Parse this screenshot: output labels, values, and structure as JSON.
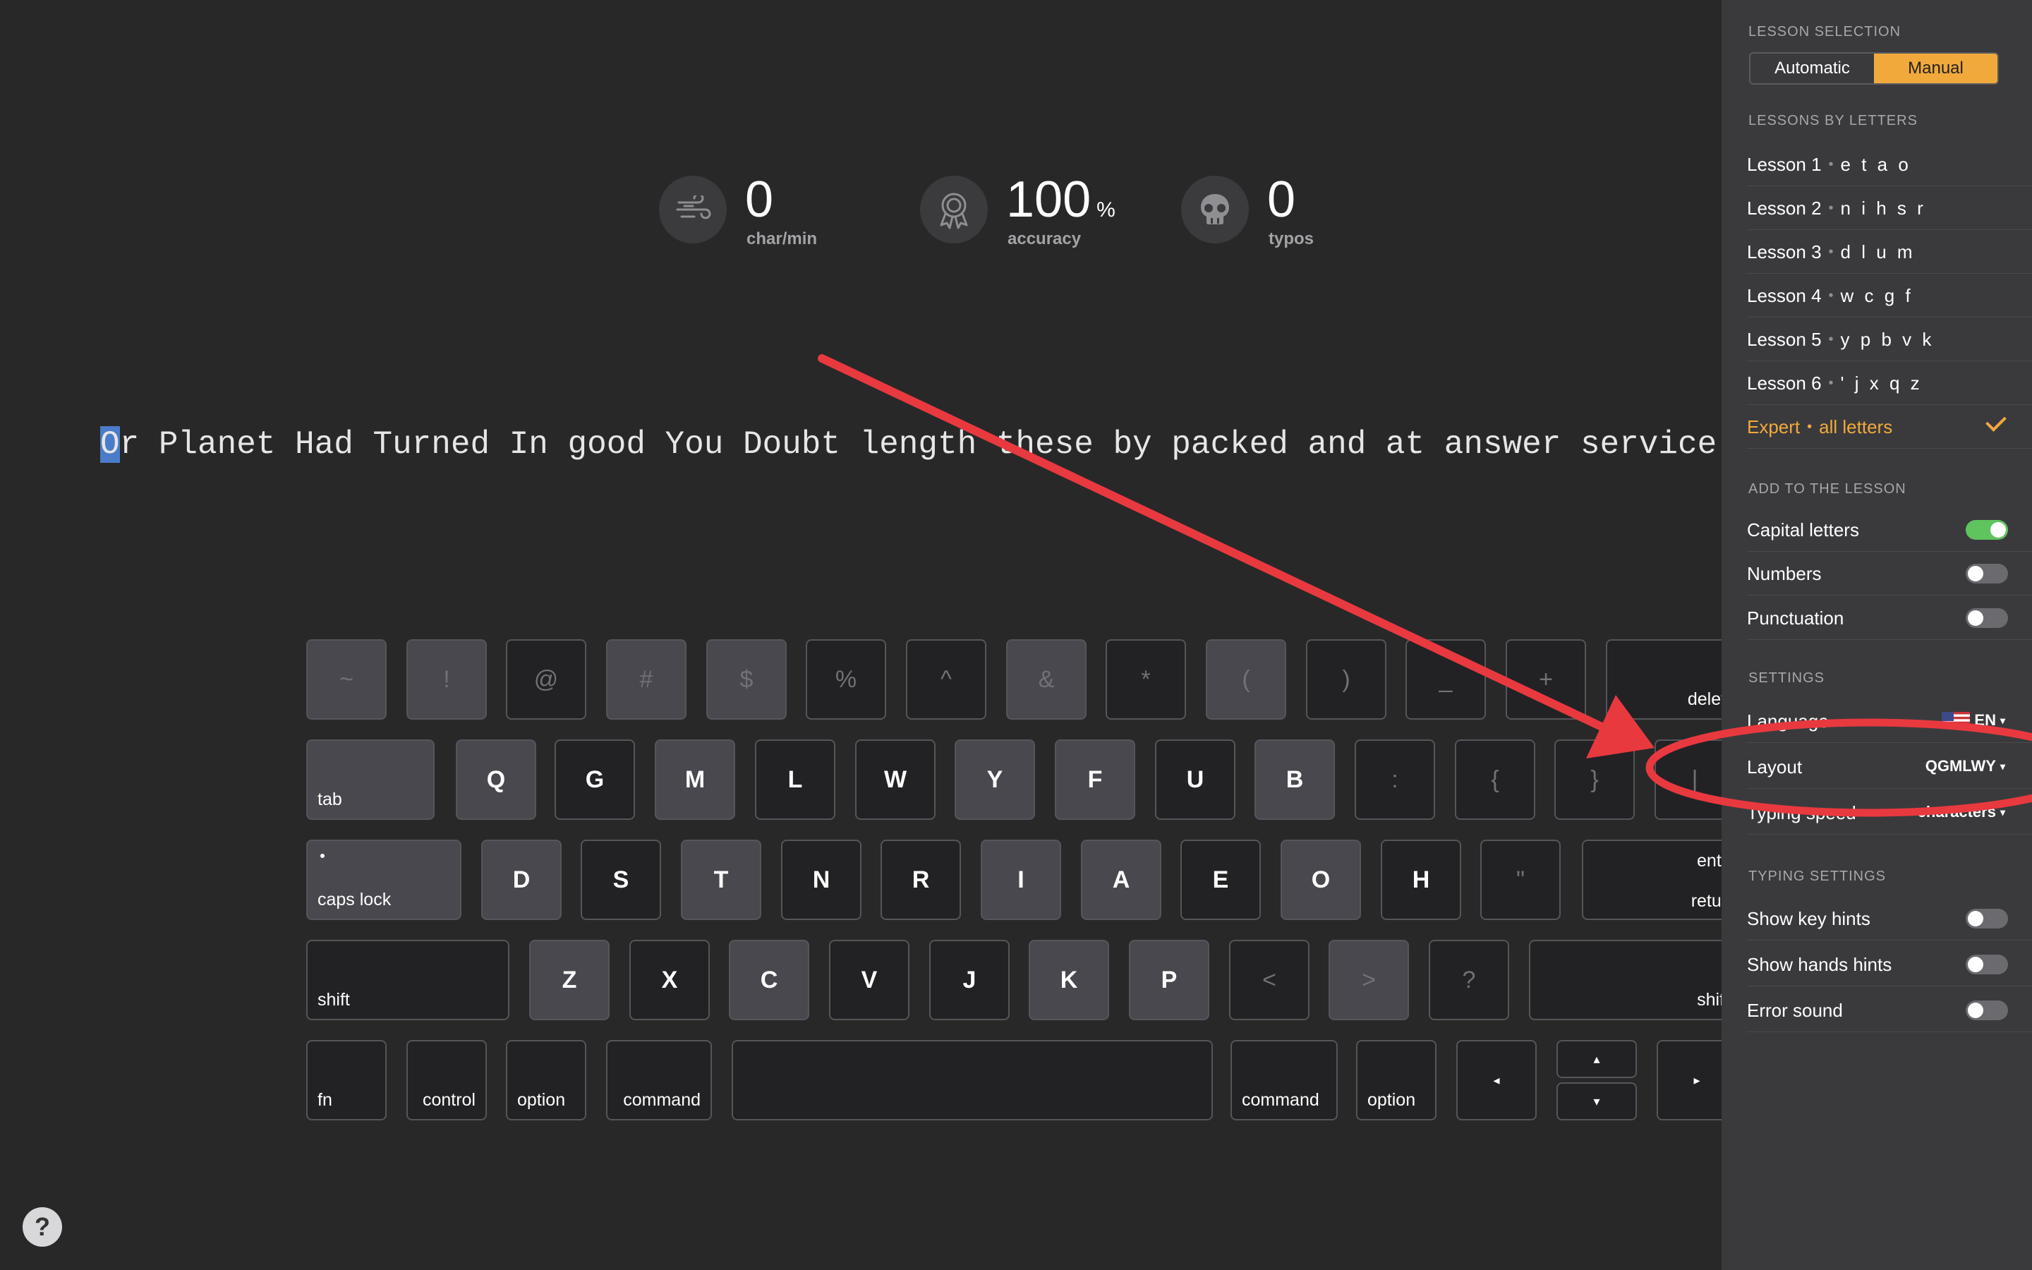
{
  "stats": [
    {
      "value": "0",
      "unit": "",
      "label": "char/min",
      "icon": "wind-icon"
    },
    {
      "value": "100",
      "unit": "%",
      "label": "accuracy",
      "icon": "award-icon"
    },
    {
      "value": "0",
      "unit": "",
      "label": "typos",
      "icon": "skull-icon"
    }
  ],
  "lesson_text": {
    "cursor_char": "O",
    "rest": "r Planet Had Turned In good You Doubt length these by packed and at answer service the m"
  },
  "keyboard": {
    "row1": [
      "~",
      "!",
      "@",
      "#",
      "$",
      "%",
      "^",
      "&",
      "*",
      "(",
      ")",
      "_",
      "+",
      "delete"
    ],
    "row2": [
      "tab",
      "Q",
      "G",
      "M",
      "L",
      "W",
      "Y",
      "F",
      "U",
      "B",
      ":",
      "{",
      "}",
      "|"
    ],
    "row3": [
      "caps lock",
      "D",
      "S",
      "T",
      "N",
      "R",
      "I",
      "A",
      "E",
      "O",
      "H",
      "\"",
      "enter",
      "return"
    ],
    "row4": [
      "shift",
      "Z",
      "X",
      "C",
      "V",
      "J",
      "K",
      "P",
      "<",
      ">",
      "?",
      "shift"
    ],
    "row5": [
      "fn",
      "control",
      "option",
      "command",
      "",
      "command",
      "option",
      "◂",
      "▴",
      "▾",
      "▸"
    ]
  },
  "help_label": "?",
  "sidebar": {
    "lesson_selection_title": "LESSON SELECTION",
    "mode_automatic": "Automatic",
    "mode_manual": "Manual",
    "lessons_title": "LESSONS BY LETTERS",
    "lessons": [
      {
        "name": "Lesson 1",
        "sep": "•",
        "letters": "e t a o"
      },
      {
        "name": "Lesson 2",
        "sep": "•",
        "letters": "n i h s r"
      },
      {
        "name": "Lesson 3",
        "sep": "•",
        "letters": "d l u m"
      },
      {
        "name": "Lesson 4",
        "sep": "•",
        "letters": "w c g f"
      },
      {
        "name": "Lesson 5",
        "sep": "•",
        "letters": "y p b v k"
      },
      {
        "name": "Lesson 6",
        "sep": "•",
        "letters": "' j x q z"
      },
      {
        "name": "Expert",
        "sep": "•",
        "letters": "all letters"
      }
    ],
    "add_title": "ADD TO THE LESSON",
    "add_options": [
      {
        "label": "Capital letters",
        "on": true
      },
      {
        "label": "Numbers",
        "on": false
      },
      {
        "label": "Punctuation",
        "on": false
      }
    ],
    "settings_title": "SETTINGS",
    "language_label": "Language",
    "language_value": "EN",
    "layout_label": "Layout",
    "layout_value": "QGMLWY",
    "typing_speed_label": "Typing speed",
    "typing_speed_value": "characters",
    "typing_title": "TYPING SETTINGS",
    "typing_options": [
      {
        "label": "Show key hints",
        "on": false
      },
      {
        "label": "Show hands hints",
        "on": false
      },
      {
        "label": "Error sound",
        "on": false
      }
    ]
  },
  "colors": {
    "accent": "#f2a93b",
    "toggle_on": "#5fc45e",
    "annotation": "#e8393f",
    "cursor": "#4a7cc9"
  }
}
